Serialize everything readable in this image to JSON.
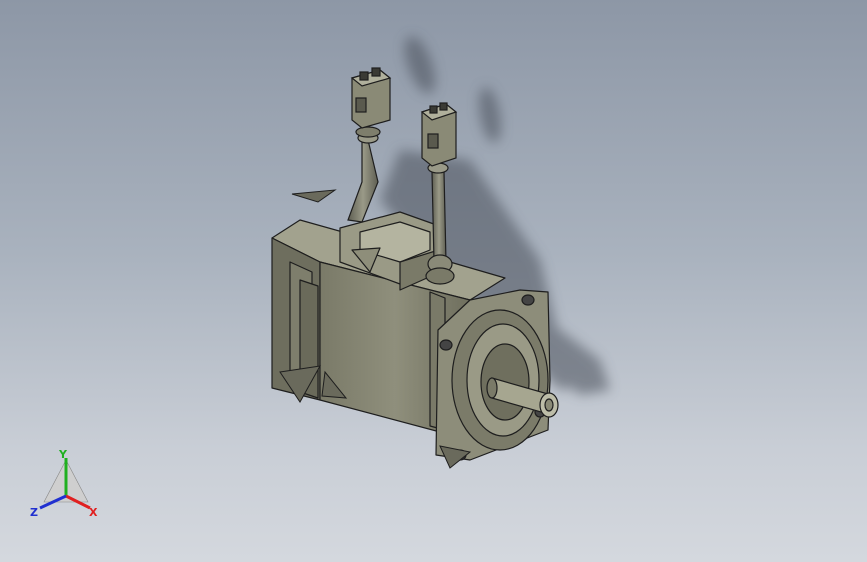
{
  "viewport": {
    "background_top": "#8d97a6",
    "background_bottom": "#d4d8de"
  },
  "model": {
    "body_color": "#8a8a78",
    "shadow_color": "#4a505a",
    "edge_color": "#1e1e1e"
  },
  "triad": {
    "x_label": "X",
    "y_label": "Y",
    "z_label": "Z",
    "x_color": "#e02020",
    "y_color": "#20b020",
    "z_color": "#2030d0"
  }
}
